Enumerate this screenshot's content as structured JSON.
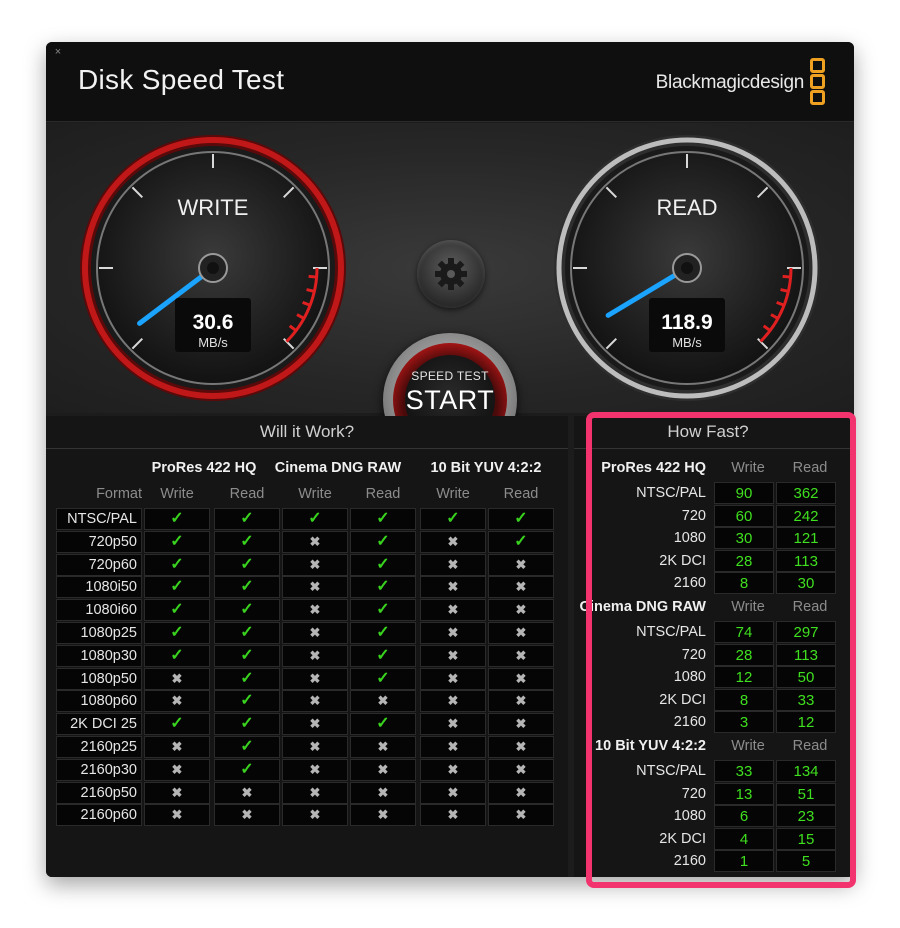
{
  "app": {
    "title": "Disk Speed Test",
    "brand": "Blackmagicdesign",
    "close_glyph": "×"
  },
  "gauges": {
    "write": {
      "label": "WRITE",
      "value": "30.6",
      "unit": "MB/s",
      "value_num": 30.6
    },
    "read": {
      "label": "READ",
      "value": "118.9",
      "unit": "MB/s",
      "value_num": 118.9
    }
  },
  "start_button": {
    "small": "SPEED TEST",
    "big": "START"
  },
  "icons": {
    "settings": "gear-icon",
    "check": "✓",
    "cross": "✖"
  },
  "colors": {
    "accent_red": "#c01818",
    "needle": "#1aa3ff",
    "ok": "#39d21e",
    "value_green": "#3fe01f",
    "highlight": "#f2336e",
    "brand_orange": "#f0a020"
  },
  "will_it_work": {
    "title": "Will it Work?",
    "format_header": "Format",
    "groups": [
      "ProRes 422 HQ",
      "Cinema DNG RAW",
      "10 Bit YUV 4:2:2"
    ],
    "subheaders": [
      "Write",
      "Read",
      "Write",
      "Read",
      "Write",
      "Read"
    ],
    "rows": [
      {
        "format": "NTSC/PAL",
        "cells": [
          1,
          1,
          1,
          1,
          1,
          1
        ]
      },
      {
        "format": "720p50",
        "cells": [
          1,
          1,
          0,
          1,
          0,
          1
        ]
      },
      {
        "format": "720p60",
        "cells": [
          1,
          1,
          0,
          1,
          0,
          0
        ]
      },
      {
        "format": "1080i50",
        "cells": [
          1,
          1,
          0,
          1,
          0,
          0
        ]
      },
      {
        "format": "1080i60",
        "cells": [
          1,
          1,
          0,
          1,
          0,
          0
        ]
      },
      {
        "format": "1080p25",
        "cells": [
          1,
          1,
          0,
          1,
          0,
          0
        ]
      },
      {
        "format": "1080p30",
        "cells": [
          1,
          1,
          0,
          1,
          0,
          0
        ]
      },
      {
        "format": "1080p50",
        "cells": [
          0,
          1,
          0,
          1,
          0,
          0
        ]
      },
      {
        "format": "1080p60",
        "cells": [
          0,
          1,
          0,
          0,
          0,
          0
        ]
      },
      {
        "format": "2K DCI 25",
        "cells": [
          1,
          1,
          0,
          1,
          0,
          0
        ]
      },
      {
        "format": "2160p25",
        "cells": [
          0,
          1,
          0,
          0,
          0,
          0
        ]
      },
      {
        "format": "2160p30",
        "cells": [
          0,
          1,
          0,
          0,
          0,
          0
        ]
      },
      {
        "format": "2160p50",
        "cells": [
          0,
          0,
          0,
          0,
          0,
          0
        ]
      },
      {
        "format": "2160p60",
        "cells": [
          0,
          0,
          0,
          0,
          0,
          0
        ]
      }
    ]
  },
  "how_fast": {
    "title": "How Fast?",
    "write_header": "Write",
    "read_header": "Read",
    "groups": [
      {
        "name": "ProRes 422 HQ",
        "rows": [
          {
            "label": "NTSC/PAL",
            "write": "90",
            "read": "362"
          },
          {
            "label": "720",
            "write": "60",
            "read": "242"
          },
          {
            "label": "1080",
            "write": "30",
            "read": "121"
          },
          {
            "label": "2K DCI",
            "write": "28",
            "read": "113"
          },
          {
            "label": "2160",
            "write": "8",
            "read": "30"
          }
        ]
      },
      {
        "name": "Cinema DNG RAW",
        "rows": [
          {
            "label": "NTSC/PAL",
            "write": "74",
            "read": "297"
          },
          {
            "label": "720",
            "write": "28",
            "read": "113"
          },
          {
            "label": "1080",
            "write": "12",
            "read": "50"
          },
          {
            "label": "2K DCI",
            "write": "8",
            "read": "33"
          },
          {
            "label": "2160",
            "write": "3",
            "read": "12"
          }
        ]
      },
      {
        "name": "10 Bit YUV 4:2:2",
        "rows": [
          {
            "label": "NTSC/PAL",
            "write": "33",
            "read": "134"
          },
          {
            "label": "720",
            "write": "13",
            "read": "51"
          },
          {
            "label": "1080",
            "write": "6",
            "read": "23"
          },
          {
            "label": "2K DCI",
            "write": "4",
            "read": "15"
          },
          {
            "label": "2160",
            "write": "1",
            "read": "5"
          }
        ]
      }
    ]
  }
}
